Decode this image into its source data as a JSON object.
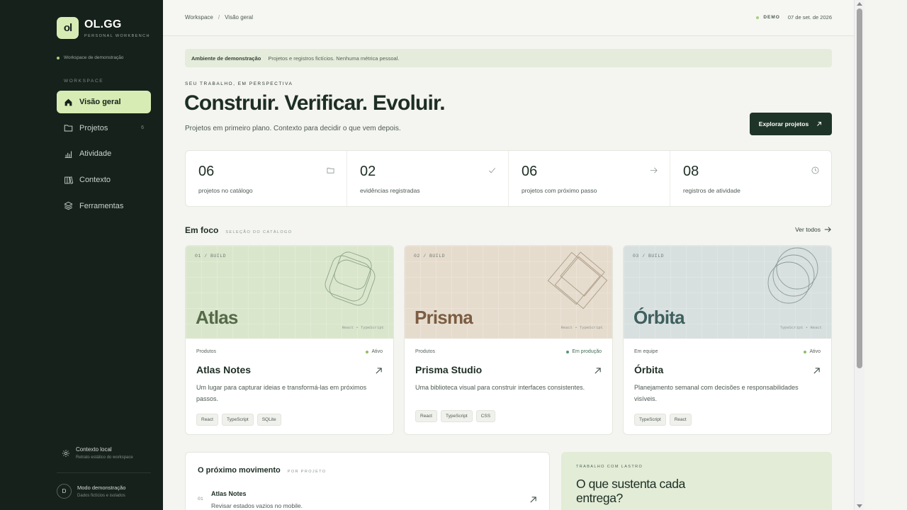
{
  "brand": {
    "mark": "ol",
    "title": "OL.GG",
    "subtitle": "PERSONAL WORKBENCH"
  },
  "sidebar": {
    "workspace_note": "Workspace de demonstração",
    "section_label": "WORKSPACE",
    "items": [
      {
        "label": "Visão geral",
        "icon": "home-icon",
        "active": true
      },
      {
        "label": "Projetos",
        "icon": "folder-icon",
        "count": "6"
      },
      {
        "label": "Atividade",
        "icon": "bar-chart-icon"
      },
      {
        "label": "Contexto",
        "icon": "book-icon"
      },
      {
        "label": "Ferramentas",
        "icon": "layers-icon"
      }
    ],
    "local_context": {
      "title": "Contexto local",
      "subtitle": "Retrato estático do workspace"
    },
    "demo_mode": {
      "avatar": "D",
      "title": "Modo demonstração",
      "subtitle": "Dados fictícios e isolados"
    }
  },
  "topbar": {
    "breadcrumb": [
      "Workspace",
      "Visão geral"
    ],
    "badge": "DEMO",
    "date": "07 de set. de 2026"
  },
  "banner": {
    "title": "Ambiente de demonstração",
    "text": "Projetos e registros fictícios. Nenhuma métrica pessoal."
  },
  "hero": {
    "eyebrow": "SEU TRABALHO, EM PERSPECTIVA",
    "title": "Construir. Verificar. Evoluir.",
    "subtitle": "Projetos em primeiro plano. Contexto para decidir o que vem depois.",
    "cta": "Explorar projetos"
  },
  "stats": [
    {
      "value": "06",
      "label": "projetos no catálogo",
      "icon": "folder-icon"
    },
    {
      "value": "02",
      "label": "evidências registradas",
      "icon": "check-icon"
    },
    {
      "value": "06",
      "label": "projetos com próximo passo",
      "icon": "arrow-right-icon"
    },
    {
      "value": "08",
      "label": "registros de atividade",
      "icon": "clock-icon"
    }
  ],
  "focus": {
    "title": "Em foco",
    "subtitle": "SELEÇÃO DO CATÁLOGO",
    "see_all": "Ver todos",
    "cards": [
      {
        "code": "01 / BUILD",
        "hero_name": "Atlas",
        "stack": "React • TypeScript",
        "category": "Produtos",
        "status": "Ativo",
        "title": "Atlas Notes",
        "description": "Um lugar para capturar ideias e transformá-las em próximos passos.",
        "tags": [
          "React",
          "TypeScript",
          "SQLite"
        ],
        "bg": "#d9e6cc",
        "name_color": "#556a49"
      },
      {
        "code": "02 / BUILD",
        "hero_name": "Prisma",
        "stack": "React • TypeScript",
        "category": "Produtos",
        "status": "Em produção",
        "title": "Prisma Studio",
        "description": "Uma biblioteca visual para construir interfaces consistentes.",
        "tags": [
          "React",
          "TypeScript",
          "CSS"
        ],
        "bg": "#e6dccd",
        "name_color": "#7a5d43"
      },
      {
        "code": "03 / BUILD",
        "hero_name": "Órbita",
        "stack": "TypeScript • React",
        "category": "Em equipe",
        "status": "Ativo",
        "title": "Órbita",
        "description": "Planejamento semanal com decisões e responsabilidades visíveis.",
        "tags": [
          "TypeScript",
          "React"
        ],
        "bg": "#d7e0df",
        "name_color": "#3f5f5e"
      }
    ]
  },
  "next_move": {
    "title": "O próximo movimento",
    "subtitle": "POR PROJETO",
    "items": [
      {
        "num": "01",
        "name": "Atlas Notes",
        "desc": "Revisar estados vazios no mobile."
      }
    ]
  },
  "backed": {
    "eyebrow": "TRABALHO COM LASTRO",
    "title": "O que sustenta cada entrega?"
  },
  "colors": {
    "sidebar_bg": "#16211b",
    "accent": "#d6ecb4",
    "cta_bg": "#1f3428",
    "status_dot": "#8fbf5f"
  }
}
